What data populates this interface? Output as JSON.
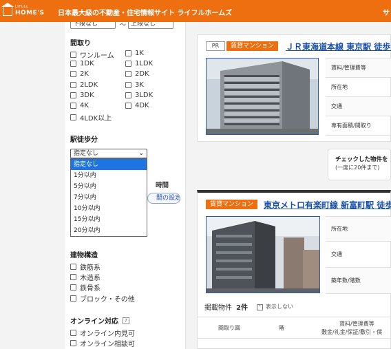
{
  "header": {
    "logo_small": "LIFULL",
    "logo_big": "HOME'S",
    "tagline": "日本最大級の不動産・住宅情報サイト ライフルホームズ",
    "right_text": "サ"
  },
  "sidebar": {
    "rent_min": "下限なし",
    "rent_tilde": "～",
    "rent_max": "上限なし",
    "layout_title": "間取り",
    "layouts": [
      "ワンルーム",
      "1K",
      "1DK",
      "1LDK",
      "2K",
      "2DK",
      "2LDK",
      "3K",
      "3DK",
      "3LDK",
      "4K",
      "4DK",
      "4LDK以上"
    ],
    "walk_title": "駅徒歩分",
    "walk_selected": "指定なし",
    "walk_options": [
      "指定なし",
      "1分以内",
      "5分以内",
      "7分以内",
      "10分以内",
      "15分以内",
      "20分以内"
    ],
    "hidden_label": "時間",
    "commute_btn": "間の設定",
    "structure_title": "建物構造",
    "structures": [
      "鉄筋系",
      "木造系",
      "鉄骨系",
      "ブロック・その他"
    ],
    "online_title": "オンライン対応",
    "online_help": "?",
    "online_items": [
      "オンライン内見可",
      "オンライン相談可"
    ]
  },
  "listing1": {
    "pr": "PR",
    "type": "賃貸マンション",
    "title": "ＪＲ東海道本線 東京駅 徒歩6",
    "rows": [
      "賃料/管理費等",
      "所在地",
      "交通",
      "専有面積/間取り"
    ]
  },
  "check_box": {
    "line1": "チェックした物件を",
    "line2": "(一度に20件まで)"
  },
  "listing2": {
    "type": "賃貸マンション",
    "title": "東京メトロ有楽町線 新富町駅 徒歩",
    "rows": [
      "所在地",
      "交通",
      "築年数/階数"
    ],
    "count_label": "掲載物件",
    "count_value": "2件",
    "toggle": "表示しない",
    "toggle_icon": "^",
    "col_layout": "間取り図",
    "col_floor": "階",
    "col_rent1": "賃料/管理費等",
    "col_rent2": "敷金/礼金/保証/敷引・償"
  }
}
